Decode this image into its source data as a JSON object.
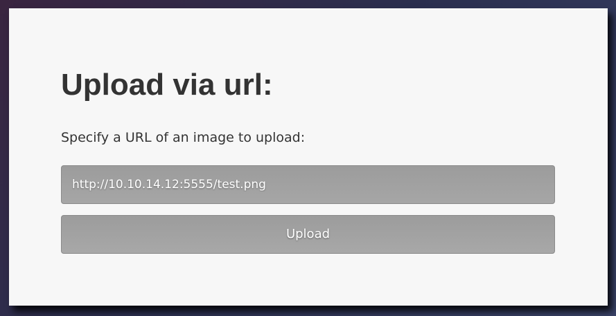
{
  "form": {
    "title": "Upload via url:",
    "instruction": "Specify a URL of an image to upload:",
    "url_value": "http://10.10.14.12:5555/test.png",
    "upload_label": "Upload"
  },
  "colors": {
    "panel_background": "#f7f7f7",
    "text": "#333333",
    "control_background": "#a2a2a2"
  }
}
